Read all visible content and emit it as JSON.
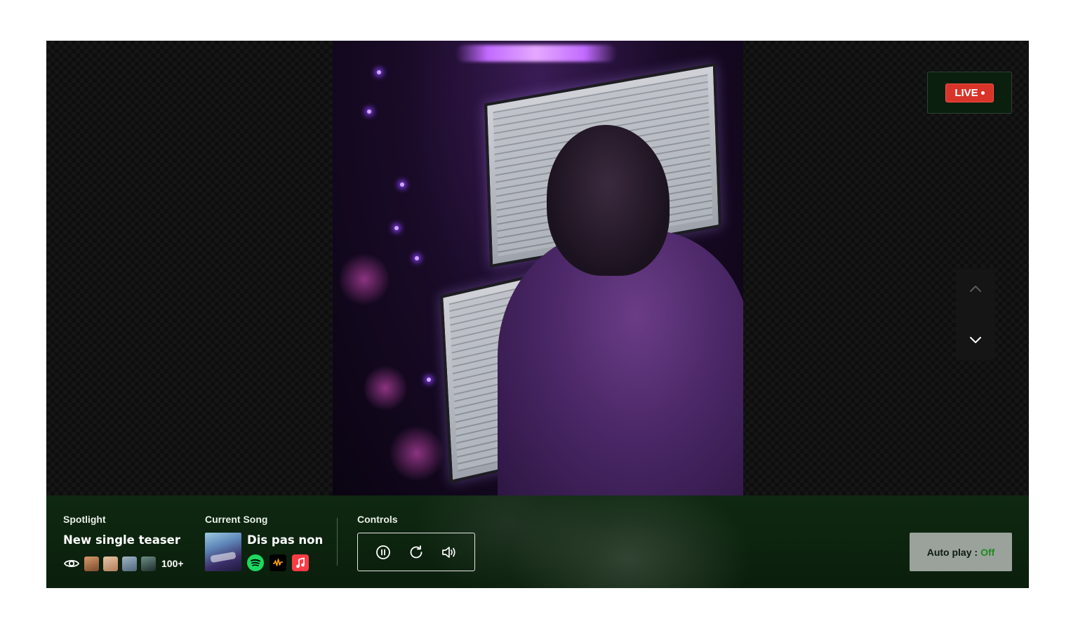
{
  "live": {
    "label": "LIVE"
  },
  "spotlight": {
    "label": "Spotlight",
    "title": "New single teaser",
    "viewer_count": "100+",
    "icons": [
      "eye-icon"
    ]
  },
  "current_song": {
    "label": "Current Song",
    "title": "Dis pas non",
    "platforms": [
      "spotify-icon",
      "audiomack-icon",
      "apple-music-icon"
    ]
  },
  "controls": {
    "label": "Controls",
    "icons": [
      "pause-icon",
      "replay-icon",
      "volume-icon"
    ]
  },
  "autoplay": {
    "label": "Auto play :",
    "state": "Off"
  },
  "navigation": {
    "icons": [
      "chevron-up-icon",
      "chevron-down-icon"
    ]
  },
  "colors": {
    "live_red": "#d8342a",
    "bar_green": "#0f2811",
    "autoplay_off": "#1d8a1f",
    "spotify": "#1ed760",
    "apple_music": "#fc3c44"
  }
}
